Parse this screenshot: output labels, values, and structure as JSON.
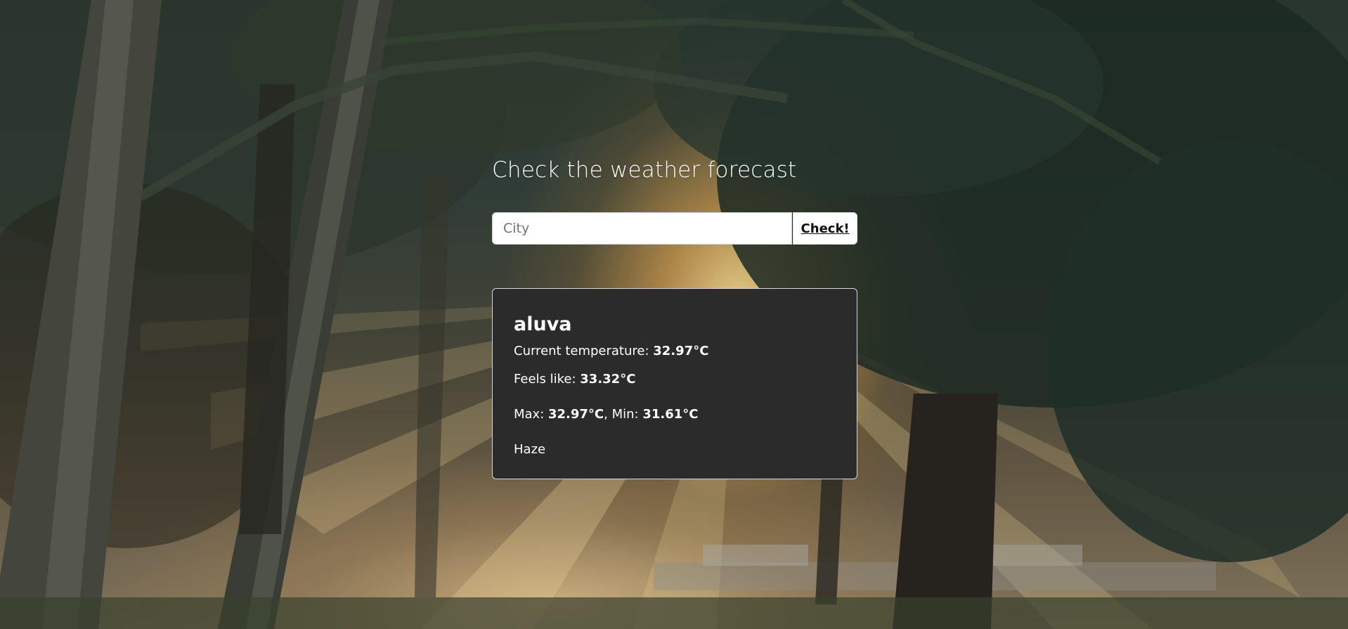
{
  "page": {
    "title": "Check the weather forecast"
  },
  "search": {
    "placeholder": "City",
    "value": "",
    "button_label": "Check!"
  },
  "weather": {
    "city": "aluva",
    "current_label": "Current temperature: ",
    "current_value": "32.97°C",
    "feels_label": "Feels like: ",
    "feels_value": "33.32°C",
    "max_label": "Max: ",
    "max_value": "32.97°C",
    "min_label": ", Min: ",
    "min_value": "31.61°C",
    "description": "Haze"
  },
  "colors": {
    "card_background": "#2b2b2b",
    "card_border": "#d6d6d6",
    "text": "#ffffff"
  }
}
